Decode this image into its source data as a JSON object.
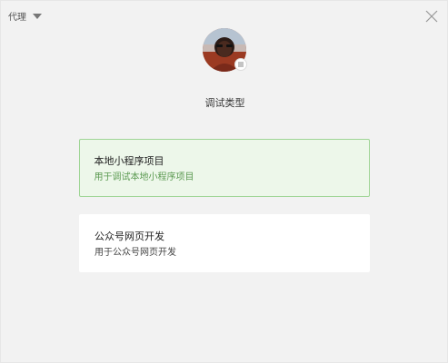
{
  "proxy": {
    "label": "代理"
  },
  "title": "调试类型",
  "options": [
    {
      "title": "本地小程序项目",
      "desc": "用于调试本地小程序项目",
      "selected": true
    },
    {
      "title": "公众号网页开发",
      "desc": "用于公众号网页开发",
      "selected": false
    }
  ],
  "icons": {
    "proxy_caret": "caret-down-icon",
    "close": "close-icon",
    "avatar_badge": "switch-account-icon"
  },
  "colors": {
    "background": "#f2f2f2",
    "selected_border": "#9fd595",
    "selected_background": "#edf7ea",
    "selected_desc": "#5b9a51",
    "card_background": "#ffffff"
  }
}
